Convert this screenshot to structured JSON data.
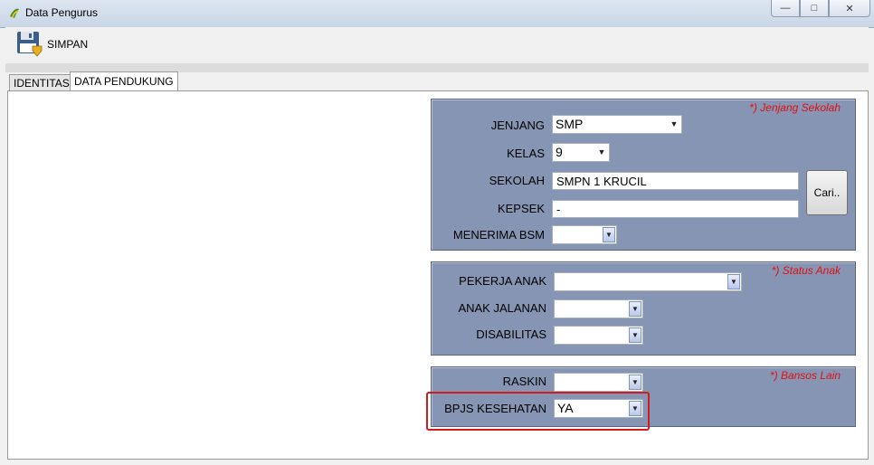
{
  "window": {
    "title": "Data Pengurus",
    "controls": [
      "minimize-icon",
      "maximize-icon",
      "close-icon"
    ]
  },
  "toolbar": {
    "save_label": "SIMPAN",
    "save_icon": "floppy-disk-icon"
  },
  "tabs": [
    {
      "label": "IDENTITAS"
    },
    {
      "label": "DATA PENDUKUNG",
      "active": true
    }
  ],
  "groups": {
    "jenjang": {
      "caption": "*) Jenjang Sekolah",
      "jenjang_label": "JENJANG",
      "jenjang_value": "SMP",
      "kelas_label": "KELAS",
      "kelas_value": "9",
      "sekolah_label": "SEKOLAH",
      "sekolah_value": "SMPN 1 KRUCIL",
      "kepsek_label": "KEPSEK",
      "kepsek_value": "-",
      "bsm_label": "MENERIMA BSM",
      "bsm_value": "",
      "cari_label": "Cari.."
    },
    "status": {
      "caption": "*) Status Anak",
      "pekerja_label": "PEKERJA ANAK",
      "pekerja_value": "",
      "jalanan_label": "ANAK JALANAN",
      "jalanan_value": "",
      "disabilitas_label": "DISABILITAS",
      "disabilitas_value": ""
    },
    "bansos": {
      "caption": "*) Bansos Lain",
      "raskin_label": "RASKIN",
      "raskin_value": "",
      "bpjs_label": "BPJS KESEHATAN",
      "bpjs_value": "YA"
    }
  },
  "colors": {
    "group_bg": "#8795b4",
    "caption": "#e01010",
    "highlight": "#d01c1c"
  }
}
